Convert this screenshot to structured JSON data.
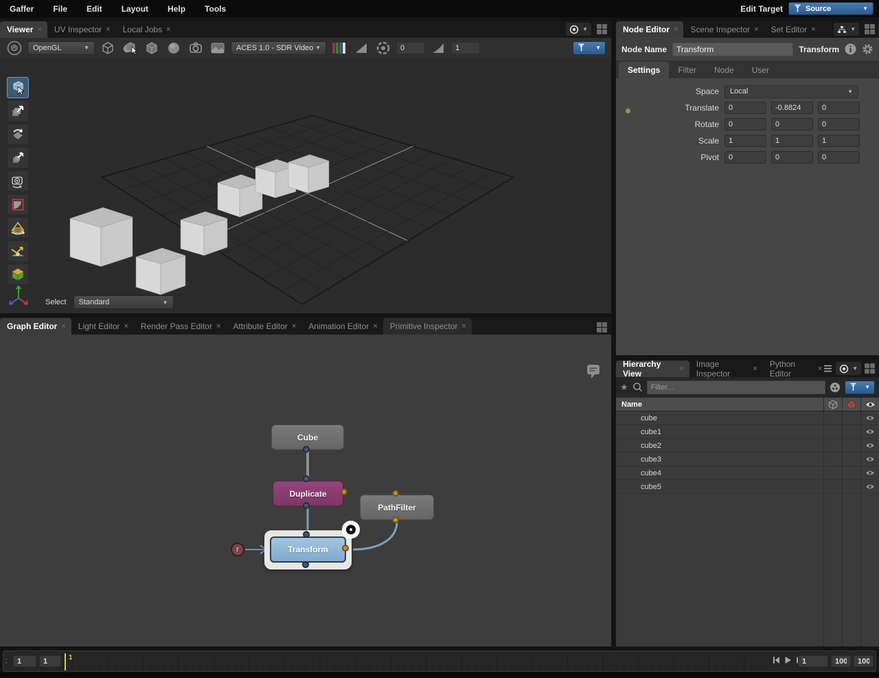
{
  "colors": {
    "accent_blue": "#3a6ea5",
    "selection_halo": "#e9e7e2",
    "node_gray": "#6e6e6e",
    "node_duplicate_magenta": "#8c3f72",
    "node_transform_blue": "#8fb7d9",
    "port_blue": "#3c5d7e",
    "port_gold": "#c39038",
    "playhead_yellow": "#e3c83c",
    "annotation_red": "#7d4648"
  },
  "menubar": {
    "items": [
      "Gaffer",
      "File",
      "Edit",
      "Layout",
      "Help",
      "Tools"
    ],
    "edit_target_label": "Edit Target",
    "edit_target_value": "Source"
  },
  "viewer": {
    "tabs": [
      "Viewer",
      "UV Inspector",
      "Local Jobs"
    ],
    "close_glyph": "×",
    "toolbar": {
      "renderer": "OpenGL",
      "display_transform": "ACES 1.0 - SDR Video",
      "exposure": "0",
      "gamma": "1",
      "icons": [
        "hand-icon",
        "shaded-cube-icon",
        "select-cube-icon",
        "wireframe-cube-icon",
        "sphere-icon",
        "camera-icon",
        "image-compare-icon",
        "rgb-channels-icon",
        "gamma-triangle-icon",
        "aperture-icon",
        "gain-icon",
        "pin-icon"
      ]
    },
    "tools": [
      "select-tool",
      "translate-tool",
      "rotate-tool",
      "scale-tool",
      "camera-tool",
      "crop-window-tool",
      "light-cone-tool",
      "light-position-tool",
      "edit-scope-tool"
    ],
    "select_label": "Select",
    "select_value": "Standard"
  },
  "node_editor": {
    "tabs": [
      "Node Editor",
      "Scene Inspector",
      "Set Editor"
    ],
    "node_name_label": "Node Name",
    "node_name_value": "Transform",
    "node_type": "Transform",
    "sub_tabs": [
      "Settings",
      "Filter",
      "Node",
      "User"
    ],
    "form": {
      "space_label": "Space",
      "space_value": "Local",
      "translate_label": "Translate",
      "translate": [
        "0",
        "-0.8824",
        "0"
      ],
      "rotate_label": "Rotate",
      "rotate": [
        "0",
        "0",
        "0"
      ],
      "scale_label": "Scale",
      "scale": [
        "1",
        "1",
        "1"
      ],
      "pivot_label": "Pivot",
      "pivot": [
        "0",
        "0",
        "0"
      ]
    }
  },
  "graph_editor": {
    "tabs": [
      "Graph Editor",
      "Light Editor",
      "Render Pass Editor",
      "Attribute Editor",
      "Animation Editor",
      "Primitive Inspector"
    ],
    "nodes": [
      {
        "name": "Cube",
        "color": "gray"
      },
      {
        "name": "Duplicate",
        "color": "magenta"
      },
      {
        "name": "PathFilter",
        "color": "gray"
      },
      {
        "name": "Transform",
        "color": "blue",
        "selected": true,
        "focused": true
      }
    ],
    "annotation_label": "r"
  },
  "hierarchy": {
    "tabs": [
      "Hierarchy View",
      "Image Inspector",
      "Python Editor"
    ],
    "filter_placeholder": "Filter...",
    "header": "Name",
    "rows": [
      {
        "name": "cube"
      },
      {
        "name": "cube1"
      },
      {
        "name": "cube2"
      },
      {
        "name": "cube3"
      },
      {
        "name": "cube4"
      },
      {
        "name": "cube5"
      }
    ]
  },
  "timeline": {
    "range_start": "1",
    "current_frame": "1",
    "playhead_label": "1",
    "frame_field": "1",
    "end_frame": "100",
    "range_end": "100"
  }
}
